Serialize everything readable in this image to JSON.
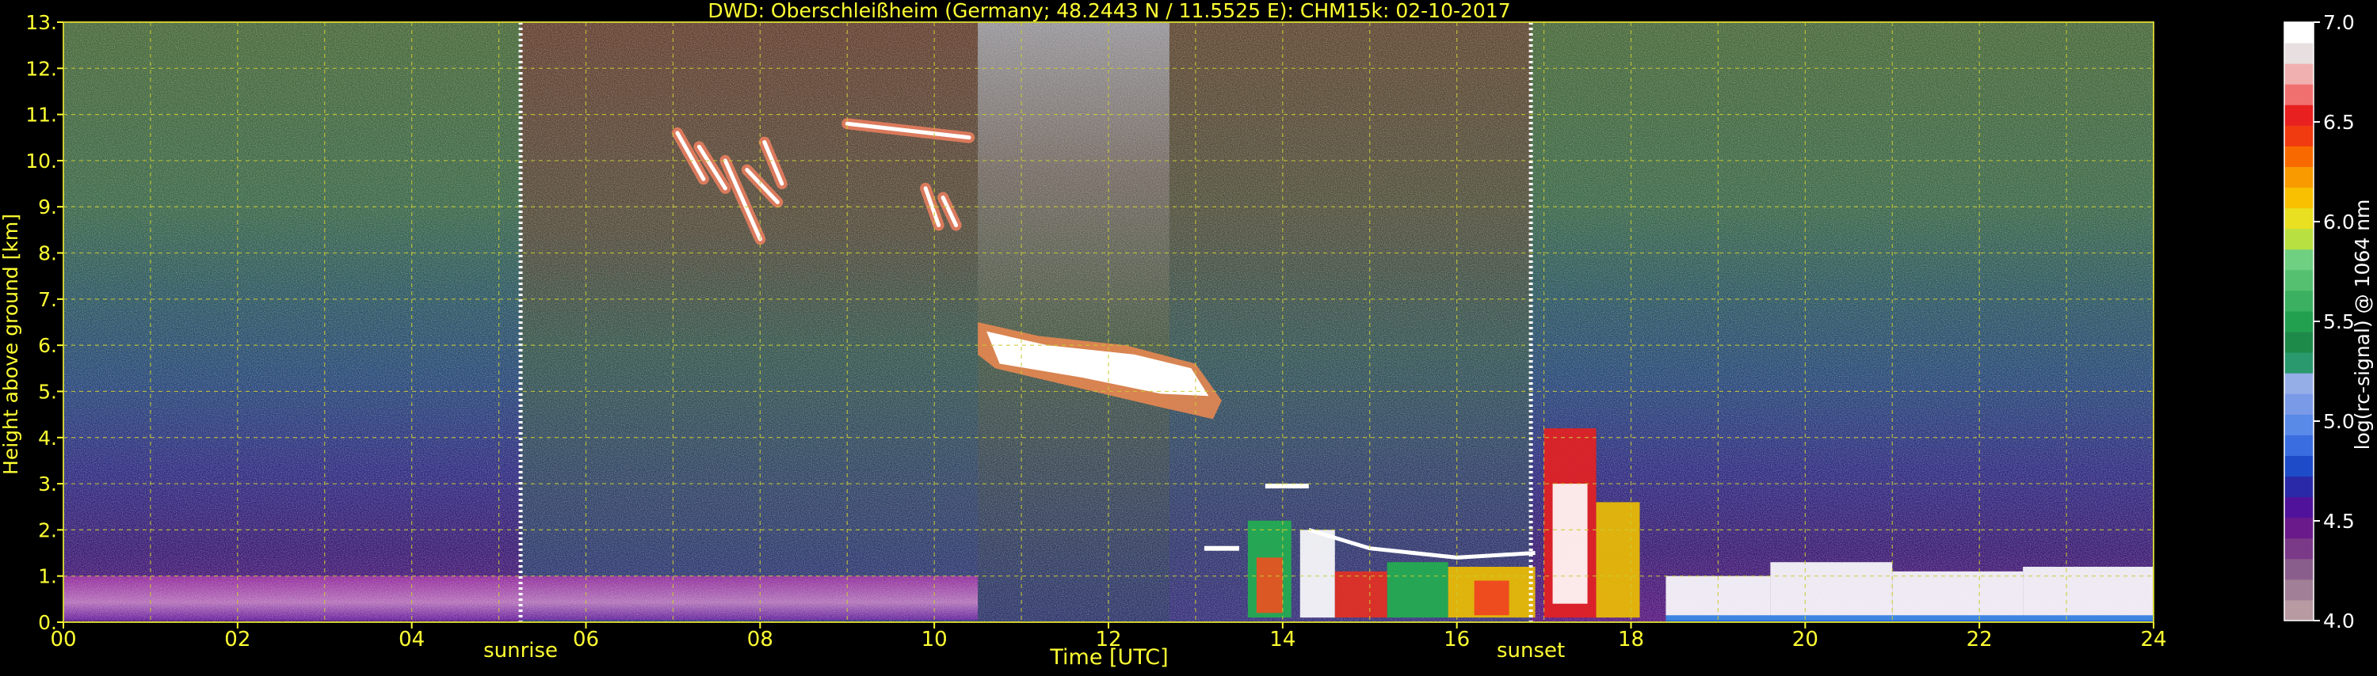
{
  "chart_data": {
    "type": "heatmap",
    "title": "DWD: Oberschleißheim (Germany; 48.2443 N / 11.5525 E):    CHM15k: 02-10-2017",
    "xlabel": "Time [UTC]",
    "ylabel": "Height above ground [km]",
    "xlim": [
      0,
      24
    ],
    "ylim": [
      0,
      13
    ],
    "x_ticks": [
      "00",
      "02",
      "04",
      "06",
      "08",
      "10",
      "12",
      "14",
      "16",
      "18",
      "20",
      "22",
      "24"
    ],
    "x_tick_values": [
      0,
      2,
      4,
      6,
      8,
      10,
      12,
      14,
      16,
      18,
      20,
      22,
      24
    ],
    "y_ticks": [
      "0.",
      "1.",
      "2.",
      "3.",
      "4.",
      "5.",
      "6.",
      "7.",
      "8.",
      "9.",
      "10.",
      "11.",
      "12.",
      "13."
    ],
    "y_tick_values": [
      0,
      1,
      2,
      3,
      4,
      5,
      6,
      7,
      8,
      9,
      10,
      11,
      12,
      13
    ],
    "grid": true,
    "annotations": [
      {
        "label": "sunrise",
        "x": 5.25
      },
      {
        "label": "sunset",
        "x": 16.85
      }
    ],
    "colorbar": {
      "label": "log(rc-signal) @ 1064 nm",
      "range": [
        4.0,
        7.0
      ],
      "ticks": [
        "4.0",
        "4.5",
        "5.0",
        "5.5",
        "6.0",
        "6.5",
        "7.0"
      ],
      "tick_values": [
        4.0,
        4.5,
        5.0,
        5.5,
        6.0,
        6.5,
        7.0
      ],
      "colors": [
        "#b89aa2",
        "#a07f97",
        "#8a5e8c",
        "#7a3a88",
        "#6a1a8a",
        "#50129a",
        "#2a2aa8",
        "#1e4cc8",
        "#3a6ee0",
        "#5a8ae8",
        "#7a9ae8",
        "#96aee8",
        "#2a9a6e",
        "#1e8a4a",
        "#22a050",
        "#3ab060",
        "#55c070",
        "#6ed080",
        "#b8e040",
        "#e8e020",
        "#f8c000",
        "#f89a00",
        "#f86a00",
        "#f03a10",
        "#e82020",
        "#f07070",
        "#f0b0b0",
        "#e8e0e0",
        "#ffffff"
      ]
    },
    "features": [
      {
        "name": "cirrus",
        "x": [
          7.0,
          10.5
        ],
        "y": [
          8.0,
          11.0
        ]
      },
      {
        "name": "mid-level cloud",
        "x": [
          10.5,
          13.5
        ],
        "y": [
          4.2,
          6.5
        ]
      },
      {
        "name": "low cloud",
        "x": [
          13.5,
          24.0
        ],
        "y": [
          0.0,
          3.0
        ]
      }
    ]
  }
}
